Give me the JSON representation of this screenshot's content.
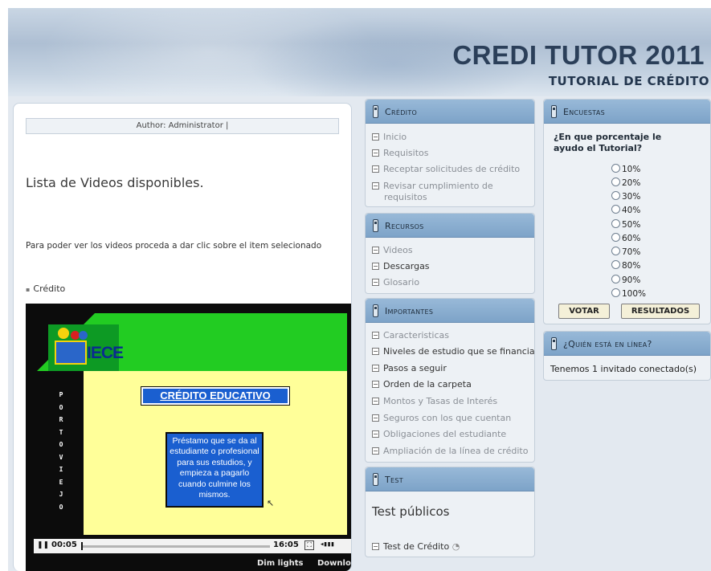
{
  "header": {
    "title": "CREDI TUTOR 2011",
    "subtitle": "TUTORIAL DE CRÉDITO"
  },
  "main": {
    "author": "Author: Administrator |",
    "heading": "Lista de Videos disponibles.",
    "intro": "Para poder ver los videos  proceda a dar clic sobre el item selecionado",
    "credit_link": "Crédito"
  },
  "video": {
    "logo_text": "IECE",
    "vertical_word": [
      "P",
      "O",
      "R",
      "T",
      "O",
      "V",
      "I",
      "E",
      "J",
      "O"
    ],
    "slide_title": "CRÉDITO EDUCATIVO",
    "slide_body": "Préstamo que se da al estudiante o profesional para sus estudios, y empieza a  pagarlo cuando culmine los mismos.",
    "time_current": "00:05",
    "time_total": "16:05",
    "progress": 0.005,
    "dim_lights": "Dim lights",
    "download": "Download"
  },
  "colors": {
    "header_text": "#2b3f59",
    "module_header": "#7da3c8",
    "slide_green": "#22cc22",
    "slide_yellow": "#ffff99",
    "slide_blue": "#1a5fd0"
  },
  "credito": {
    "title": "Crédito",
    "items": [
      "Inicio",
      "Requisitos",
      "Receptar solicitudes de crédito",
      "Revisar cumplimiento de",
      "requisitos"
    ]
  },
  "recursos": {
    "title": "Recursos",
    "items": [
      "Videos",
      "Descargas",
      "Glosario"
    ]
  },
  "importantes": {
    "title": "Importantes",
    "items": [
      "Caracteristicas",
      "Niveles de estudio que se financia",
      "Pasos a seguir",
      "Orden de la carpeta",
      "Montos y Tasas de Interés",
      "Seguros con los que cuentan",
      "Obligaciones del estudiante",
      "Ampliación de la línea de crédito"
    ]
  },
  "test": {
    "title": "Test",
    "heading": "Test públicos",
    "item": "Test de Crédito"
  },
  "encuestas": {
    "title": "Encuestas",
    "question": "¿En que porcentaje le ayudo el Tutorial?",
    "options": [
      "10%",
      "20%",
      "30%",
      "40%",
      "50%",
      "60%",
      "70%",
      "80%",
      "90%",
      "100%"
    ],
    "vote_button": "VOTAR",
    "results_button": "RESULTADOS"
  },
  "online": {
    "title": "¿Quién está en línea?",
    "text": "Tenemos 1 invitado conectado(s)"
  }
}
